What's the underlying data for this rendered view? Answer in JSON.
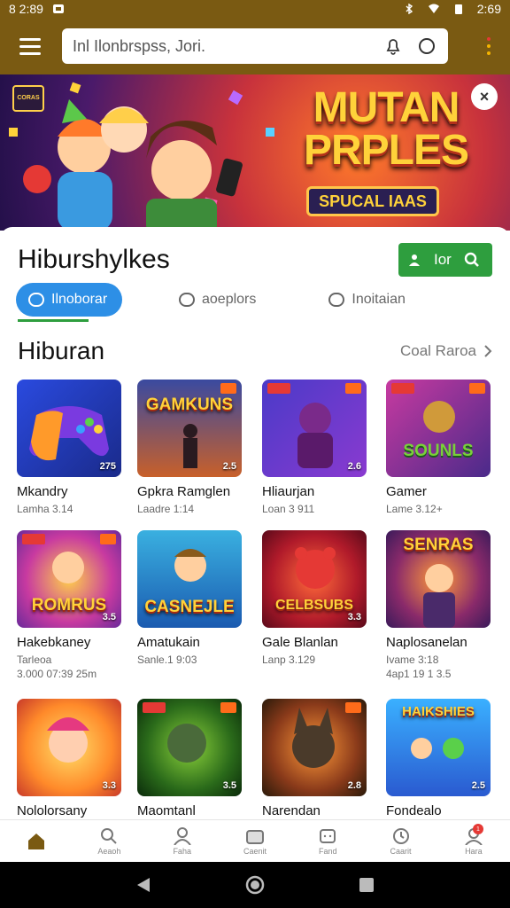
{
  "status_bar": {
    "time_left": "8 2:89",
    "time_right": "2:69"
  },
  "search": {
    "value": "Inl Ilonbrspss, Jori."
  },
  "banner": {
    "title_line1": "MUTAN",
    "title_line2": "PRPLES",
    "subtitle": "SPUCAL IAAS",
    "badge": "CORAS",
    "close_label": "×"
  },
  "sheet": {
    "title": "Hiburshylkes",
    "follow_count": "Ior"
  },
  "tabs": [
    {
      "label": "Ilnoborar"
    },
    {
      "label": "aoeplors"
    },
    {
      "label": "Inoitaian"
    }
  ],
  "section": {
    "title": "Hiburan",
    "see_all": "Coal Raroa"
  },
  "games": [
    {
      "name": "Mkandry",
      "meta": "Lamha 3.14",
      "rating": "275",
      "art": "GAMEPAD"
    },
    {
      "name": "Gpkra Ramglen",
      "meta": "Laadre 1:14",
      "rating": "2.5",
      "art": "GAMKUNS"
    },
    {
      "name": "Hliaurjan",
      "meta": "Loan 3 911",
      "rating": "2.6",
      "art": ""
    },
    {
      "name": "Gamer",
      "meta": "Lame 3.12+",
      "rating": "",
      "art": "SOUNLS"
    },
    {
      "name": "Hakebkaney",
      "meta": "Tarleoa",
      "meta2": "3.000 07:39 25m",
      "rating": "3.5",
      "art": "ROMRUS"
    },
    {
      "name": "Amatukain",
      "meta": "Sanle.1 9:03",
      "rating": "",
      "art": "CASNEJLE"
    },
    {
      "name": "Gale Blanlan",
      "meta": "Lanp 3.129",
      "rating": "3.3",
      "art": "CELBSUBS"
    },
    {
      "name": "Naplosanelan",
      "meta": "Ivame 3:18",
      "meta2": "4ap1 19 1 3.5",
      "rating": "",
      "art": "SENRAS"
    },
    {
      "name": "Nololorsany",
      "meta": "",
      "rating": "3.3",
      "art": ""
    },
    {
      "name": "Maomtanl",
      "meta": "",
      "rating": "3.5",
      "art": ""
    },
    {
      "name": "Narendan",
      "meta": "",
      "rating": "2.8",
      "art": ""
    },
    {
      "name": "Fondealo",
      "meta": "",
      "rating": "2.5",
      "art": "HAIKSHIES"
    }
  ],
  "bottom_nav": [
    {
      "label": "",
      "icon": "home-icon"
    },
    {
      "label": "Aeaoh",
      "icon": "search-icon"
    },
    {
      "label": "Faha",
      "icon": "profile-icon"
    },
    {
      "label": "Caenit",
      "icon": "cart-icon"
    },
    {
      "label": "Fand",
      "icon": "chat-icon"
    },
    {
      "label": "Caarit",
      "icon": "clock-icon"
    },
    {
      "label": "Hara",
      "icon": "account-icon",
      "badge": "1"
    }
  ],
  "colors": {
    "appbar": "#7a5a12",
    "accent_green": "#2e9e3e",
    "accent_blue": "#2d8fe6"
  }
}
